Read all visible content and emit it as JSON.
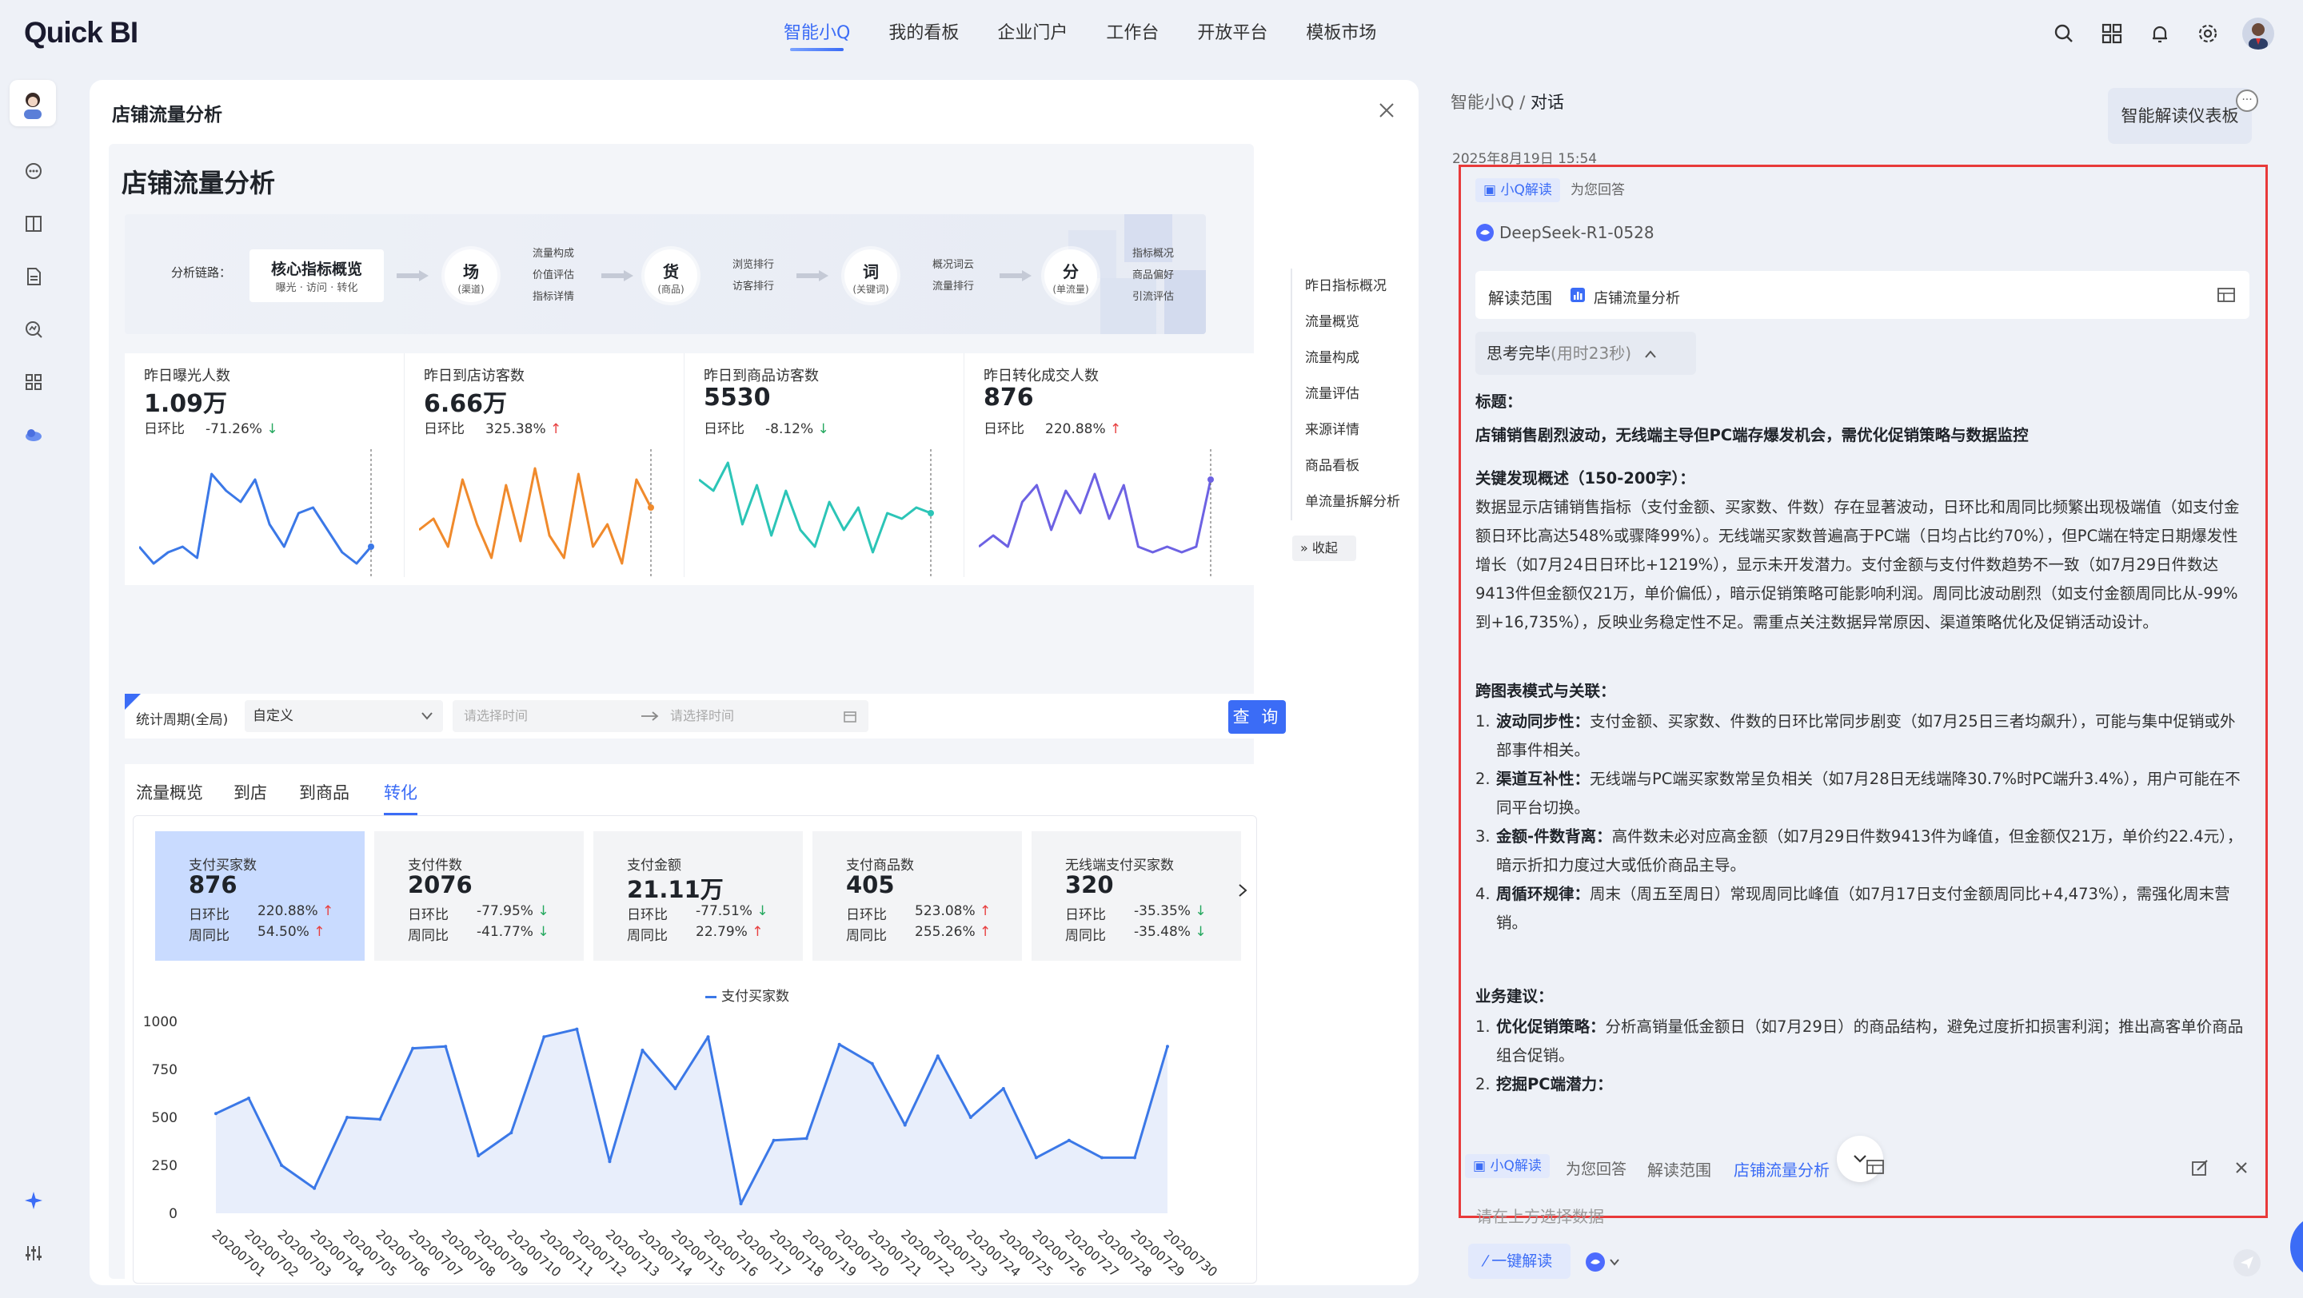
{
  "app": {
    "logo": "Quick BI"
  },
  "nav": {
    "items": [
      "智能小Q",
      "我的看板",
      "企业门户",
      "工作台",
      "开放平台",
      "模板市场"
    ],
    "active_index": 0
  },
  "left_panel": {
    "title": "店铺流量分析",
    "dashboard_title": "店铺流量分析",
    "flow": {
      "label": "分析链路：",
      "core": {
        "title": "核心指标概览",
        "sub": "曝光 · 访问 · 转化"
      },
      "nodes": [
        {
          "main": "场",
          "sub": "(渠道)",
          "items": [
            "流量构成",
            "价值评估",
            "指标详情"
          ]
        },
        {
          "main": "货",
          "sub": "(商品)",
          "items": [
            "浏览排行",
            "访客排行"
          ]
        },
        {
          "main": "词",
          "sub": "(关键词)",
          "items": [
            "概况词云",
            "流量排行"
          ]
        },
        {
          "main": "分",
          "sub": "(单流量)",
          "items": [
            "指标概况",
            "商品偏好",
            "引流评估"
          ]
        }
      ]
    },
    "kpis": [
      {
        "label": "昨日曝光人数",
        "value": "1.09万",
        "cmp_label": "日环比",
        "cmp": "-71.26%",
        "dir": "down",
        "color": "#3b78e7"
      },
      {
        "label": "昨日到店访客数",
        "value": "6.66万",
        "cmp_label": "日环比",
        "cmp": "325.38%",
        "dir": "up",
        "color": "#f08a2c"
      },
      {
        "label": "昨日到商品访客数",
        "value": "5530",
        "cmp_label": "日环比",
        "cmp": "-8.12%",
        "dir": "down",
        "color": "#2cc5b7"
      },
      {
        "label": "昨日转化成交人数",
        "value": "876",
        "cmp_label": "日环比",
        "cmp": "220.88%",
        "dir": "up",
        "color": "#6d62e3"
      }
    ],
    "toc": [
      "昨日指标概况",
      "流量概览",
      "流量构成",
      "流量评估",
      "来源详情",
      "商品看板",
      "单流量拆解分析"
    ],
    "toc_collapse": "收起",
    "filter": {
      "label": "统计周期(全局)",
      "select": "自定义",
      "date_start_placeholder": "请选择时间",
      "date_end_placeholder": "请选择时间",
      "query": "查 询"
    },
    "tabs": [
      "流量概览",
      "到店",
      "到商品",
      "转化"
    ],
    "active_tab": 3,
    "cards": [
      {
        "label": "支付买家数",
        "value": "876",
        "r1_label": "日环比",
        "r1": "220.88%",
        "r1_dir": "up",
        "r2_label": "周同比",
        "r2": "54.50%",
        "r2_dir": "up",
        "selected": true
      },
      {
        "label": "支付件数",
        "value": "2076",
        "r1_label": "日环比",
        "r1": "-77.95%",
        "r1_dir": "down",
        "r2_label": "周同比",
        "r2": "-41.77%",
        "r2_dir": "down",
        "selected": false
      },
      {
        "label": "支付金额",
        "value": "21.11万",
        "r1_label": "日环比",
        "r1": "-77.51%",
        "r1_dir": "down",
        "r2_label": "周同比",
        "r2": "22.79%",
        "r2_dir": "up",
        "selected": false
      },
      {
        "label": "支付商品数",
        "value": "405",
        "r1_label": "日环比",
        "r1": "523.08%",
        "r1_dir": "up",
        "r2_label": "周同比",
        "r2": "255.26%",
        "r2_dir": "up",
        "selected": false
      },
      {
        "label": "无线端支付买家数",
        "value": "320",
        "r1_label": "日环比",
        "r1": "-35.35%",
        "r1_dir": "down",
        "r2_label": "周同比",
        "r2": "-35.48%",
        "r2_dir": "down",
        "selected": false
      }
    ]
  },
  "chart_data": {
    "type": "line",
    "legend": "支付买家数",
    "x": [
      "20200701",
      "20200702",
      "20200703",
      "20200704",
      "20200705",
      "20200706",
      "20200707",
      "20200708",
      "20200709",
      "20200710",
      "20200711",
      "20200712",
      "20200713",
      "20200714",
      "20200715",
      "20200716",
      "20200717",
      "20200718",
      "20200719",
      "20200720",
      "20200721",
      "20200722",
      "20200723",
      "20200724",
      "20200725",
      "20200726",
      "20200727",
      "20200728",
      "20200729",
      "20200730"
    ],
    "series": [
      {
        "name": "支付买家数",
        "values": [
          520,
          600,
          250,
          130,
          500,
          490,
          860,
          870,
          300,
          420,
          920,
          960,
          270,
          850,
          650,
          920,
          50,
          380,
          390,
          880,
          780,
          460,
          820,
          500,
          650,
          290,
          380,
          290,
          290,
          870
        ]
      }
    ],
    "yticks": [
      "1000",
      "750",
      "500",
      "250",
      "0"
    ],
    "ylim": [
      0,
      1000
    ]
  },
  "right_panel": {
    "breadcrumb_root": "智能小Q",
    "breadcrumb_sep": "/",
    "breadcrumb_current": "对话",
    "interpret_button": "智能解读仪表板",
    "timestamp": "2025年8月19日 15:54",
    "badge": "小Q解读",
    "badge_suffix": "为您回答",
    "model": "DeepSeek-R1-0528",
    "scope_label": "解读范围",
    "scope_value": "店铺流量分析",
    "think": "思考完毕",
    "think_time": "(用时23秒)",
    "title_label": "标题：",
    "title_text": "店铺销售剧烈波动，无线端主导但PC端存爆发机会，需优化促销策略与数据监控",
    "key_label": "关键发现概述（150-200字）：",
    "key_text": "数据显示店铺销售指标（支付金额、买家数、件数）存在显著波动，日环比和周同比频繁出现极端值（如支付金额日环比高达548%或骤降99%）。无线端买家数普遍高于PC端（日均占比约70%），但PC端在特定日期爆发性增长（如7月24日日环比+1219%），显示未开发潜力。支付金额与支付件数趋势不一致（如7月29日件数达9413件但金额仅21万，单价偏低），暗示促销策略可能影响利润。周同比波动剧烈（如支付金额周同比从-99%到+16,735%），反映业务稳定性不足。需重点关注数据异常原因、渠道策略优化及促销活动设计。",
    "cross_label": "跨图表模式与关联：",
    "cross_items": [
      {
        "num": "1.",
        "head": "波动同步性：",
        "text": "支付金额、买家数、件数的日环比常同步剧变（如7月25日三者均飙升），可能与集中促销或外部事件相关。"
      },
      {
        "num": "2.",
        "head": "渠道互补性：",
        "text": "无线端与PC端买家数常呈负相关（如7月28日无线端降30.7%时PC端升3.4%），用户可能在不同平台切换。"
      },
      {
        "num": "3.",
        "head": "金额-件数背离：",
        "text": "高件数未必对应高金额（如7月29日件数9413件为峰值，但金额仅21万，单价约22.4元），暗示折扣力度过大或低价商品主导。"
      },
      {
        "num": "4.",
        "head": "周循环规律：",
        "text": "周末（周五至周日）常现周同比峰值（如7月17日支付金额周同比+4,473%），需强化周末营销。"
      }
    ],
    "biz_label": "业务建议：",
    "biz_items": [
      {
        "num": "1.",
        "head": "优化促销策略：",
        "text": "分析高销量低金额日（如7月29日）的商品结构，避免过度折扣损害利润；推出高客单价商品组合促销。"
      },
      {
        "num": "2.",
        "head": "挖掘PC端潜力：",
        "text": ""
      }
    ],
    "bottom": {
      "badge": "小Q解读",
      "suffix": "为您回答",
      "scope_label": "解读范围",
      "scope_value": "店铺流量分析",
      "input_placeholder": "请在上方选择数据",
      "one_click": "一键解读"
    }
  }
}
